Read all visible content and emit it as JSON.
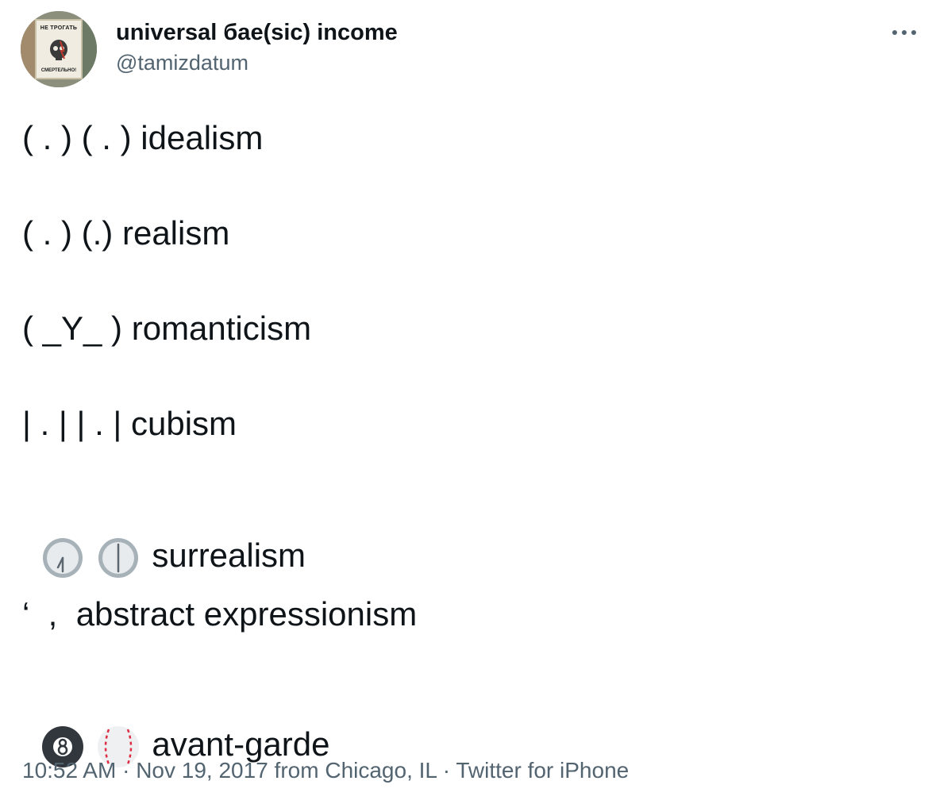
{
  "user": {
    "display_name": "universal бae(sic) income",
    "handle": "@tamizdatum",
    "avatar_text_top": "НЕ ТРОГАТЬ",
    "avatar_text_bottom": "СМЕРТЕЛЬНО!"
  },
  "tweet": {
    "lines": [
      {
        "art": "( . ) ( . ) ",
        "label": "idealism"
      },
      {
        "art": "( . ) (.) ",
        "label": "realism"
      },
      {
        "art": "( _Y_ ) ",
        "label": "romanticism"
      },
      {
        "art": "| . | | . | ",
        "label": "cubism"
      },
      {
        "icons": [
          "clock-seven-icon",
          "clock-six-icon"
        ],
        "label": "surrealism"
      },
      {
        "art": "‘  ,  ",
        "label": "abstract expressionism"
      },
      {
        "icons": [
          "eight-ball-icon",
          "baseball-icon"
        ],
        "label": "avant-garde"
      }
    ]
  },
  "meta": {
    "time": "10:52 AM",
    "sep1": " · ",
    "date": "Nov 19, 2017",
    "from_text": " from ",
    "location": "Chicago, IL",
    "sep2": " · ",
    "source": "Twitter for iPhone"
  },
  "colors": {
    "text": "#0f1419",
    "secondary": "#536471"
  }
}
